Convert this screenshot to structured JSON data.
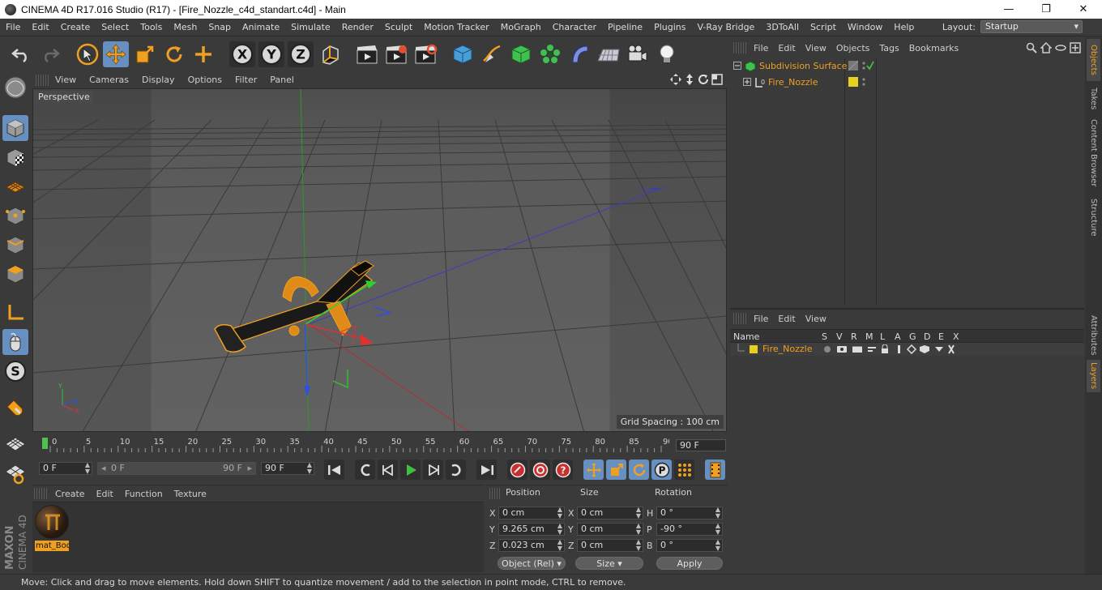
{
  "window": {
    "title": "CINEMA 4D R17.016 Studio (R17) - [Fire_Nozzle_c4d_standart.c4d] - Main",
    "minimize": "—",
    "maximize": "❐",
    "close": "✕"
  },
  "menu": [
    "File",
    "Edit",
    "Create",
    "Select",
    "Tools",
    "Mesh",
    "Snap",
    "Animate",
    "Simulate",
    "Render",
    "Sculpt",
    "Motion Tracker",
    "MoGraph",
    "Character",
    "Pipeline",
    "Plugins",
    "V-Ray Bridge",
    "3DToAll",
    "Script",
    "Window",
    "Help"
  ],
  "layout": {
    "label": "Layout:",
    "value": "Startup"
  },
  "toolbar": {
    "x_label": "X",
    "y_label": "Y",
    "z_label": "Z"
  },
  "viewport": {
    "menu": [
      "View",
      "Cameras",
      "Display",
      "Options",
      "Filter",
      "Panel"
    ],
    "camera_label": "Perspective",
    "grid_spacing": "Grid Spacing : 100 cm"
  },
  "timeline": {
    "ticks": [
      "0",
      "5",
      "10",
      "15",
      "20",
      "25",
      "30",
      "35",
      "40",
      "45",
      "50",
      "55",
      "60",
      "65",
      "70",
      "75",
      "80",
      "85",
      "90"
    ],
    "end_frame": "90 F"
  },
  "playback": {
    "current_frame": "0 F",
    "range_start": "0 F",
    "range_end": "90 F",
    "max_frame": "90 F"
  },
  "material_manager": {
    "menu": [
      "Create",
      "Edit",
      "Function",
      "Texture"
    ],
    "materials": [
      {
        "name": "mat_Bod"
      }
    ]
  },
  "coordinates": {
    "headers": {
      "position": "Position",
      "size": "Size",
      "rotation": "Rotation"
    },
    "position": {
      "x": "0 cm",
      "y": "9.265 cm",
      "z": "0.023 cm"
    },
    "size": {
      "x": "0 cm",
      "y": "0 cm",
      "z": "0 cm"
    },
    "rotation": {
      "h": "0 °",
      "p": "-90 °",
      "b": "0 °"
    },
    "axis_labels": {
      "x": "X",
      "y": "Y",
      "z": "Z",
      "h": "H",
      "p": "P",
      "b": "B"
    },
    "mode_select": "Object (Rel)",
    "size_select": "Size",
    "apply": "Apply"
  },
  "object_manager": {
    "menu": [
      "File",
      "Edit",
      "View",
      "Objects",
      "Tags",
      "Bookmarks"
    ],
    "objects": [
      {
        "name": "Subdivision Surface"
      },
      {
        "name": "Fire_Nozzle"
      }
    ]
  },
  "layer_manager": {
    "menu": [
      "File",
      "Edit",
      "View"
    ],
    "columns": [
      "Name",
      "S",
      "V",
      "R",
      "M",
      "L",
      "A",
      "G",
      "D",
      "E",
      "X"
    ],
    "layers": [
      {
        "name": "Fire_Nozzle",
        "color": "#e8d020"
      }
    ]
  },
  "right_tabs": [
    "Objects",
    "Takes",
    "Content Browser",
    "Structure",
    "Attributes",
    "Layers"
  ],
  "status": "Move: Click and drag to move elements. Hold down SHIFT to quantize movement / add to the selection in point mode, CTRL to remove.",
  "brand": {
    "line1": "MAXON",
    "line2": "CINEMA 4D"
  },
  "colors": {
    "accent": "#6790c2",
    "selected_text": "#f0a020",
    "x_axis": "#e03030",
    "y_axis": "#30c030",
    "z_axis": "#3050e0"
  }
}
